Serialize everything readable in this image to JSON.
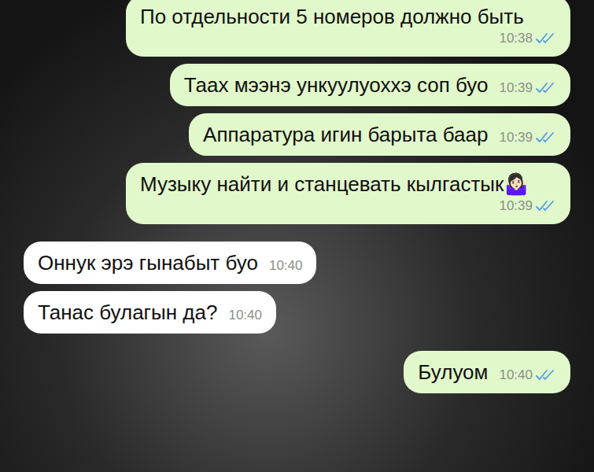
{
  "messages": [
    {
      "kind": "outgoing",
      "text": "По отдельности 5 номеров должно быть",
      "time": "10:38",
      "read": true
    },
    {
      "kind": "outgoing",
      "text": "Таах мээнэ ункуулуоххэ соп буо",
      "time": "10:39",
      "read": true
    },
    {
      "kind": "outgoing",
      "text": "Аппаратура игин барыта баар",
      "time": "10:39",
      "read": true
    },
    {
      "kind": "outgoing",
      "text": "Музыку найти и станцевать кылгастык🤷🏻‍♀️",
      "time": "10:39",
      "read": true
    },
    {
      "kind": "incoming",
      "text": "Оннук эрэ гынабыт буо",
      "time": "10:40",
      "read": false
    },
    {
      "kind": "incoming",
      "text": "Танас булагын да?",
      "time": "10:40",
      "read": false
    },
    {
      "kind": "outgoing",
      "text": "Булуом",
      "time": "10:40",
      "read": true
    }
  ]
}
